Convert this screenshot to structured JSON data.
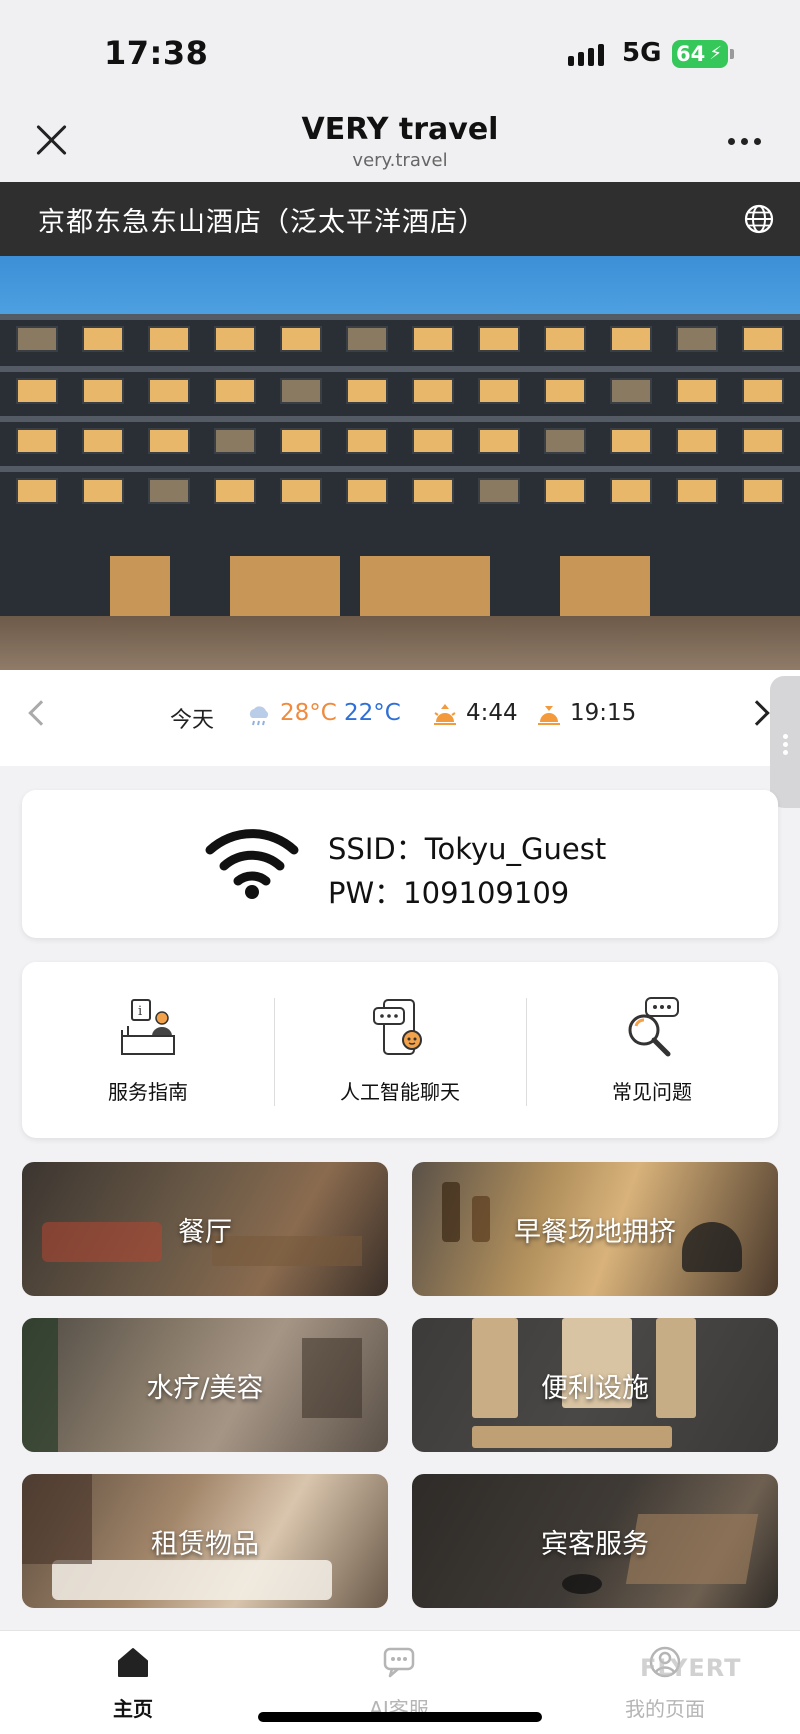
{
  "status_bar": {
    "time": "17:38",
    "network": "5G",
    "battery": "64"
  },
  "nav": {
    "title": "VERY travel",
    "domain": "very.travel"
  },
  "hotel": {
    "name": "京都东急东山酒店（泛太平洋酒店）"
  },
  "weather": {
    "day_label": "今天",
    "high": "28°C",
    "low": "22°C",
    "sunrise": "4:44",
    "sunset": "19:15",
    "high_color": "#f08a3c",
    "low_color": "#2e6fd8"
  },
  "wifi": {
    "ssid": "SSID：Tokyu_Guest",
    "password": "PW：109109109"
  },
  "actions": [
    {
      "label": "服务指南",
      "icon": "reception-desk-icon"
    },
    {
      "label": "人工智能聊天",
      "icon": "ai-chat-phone-icon"
    },
    {
      "label": "常见问题",
      "icon": "faq-search-icon"
    }
  ],
  "tiles": [
    {
      "label": "餐厅"
    },
    {
      "label": "早餐场地拥挤"
    },
    {
      "label": "水疗/美容"
    },
    {
      "label": "便利设施"
    },
    {
      "label": "租赁物品"
    },
    {
      "label": "宾客服务"
    }
  ],
  "tabbar": [
    {
      "label": "主页",
      "icon": "home-icon",
      "active": true
    },
    {
      "label": "AI客服",
      "icon": "chat-bubble-icon",
      "active": false
    },
    {
      "label": "我的页面",
      "icon": "user-circle-icon",
      "active": false
    }
  ],
  "watermark": "FLYERT"
}
